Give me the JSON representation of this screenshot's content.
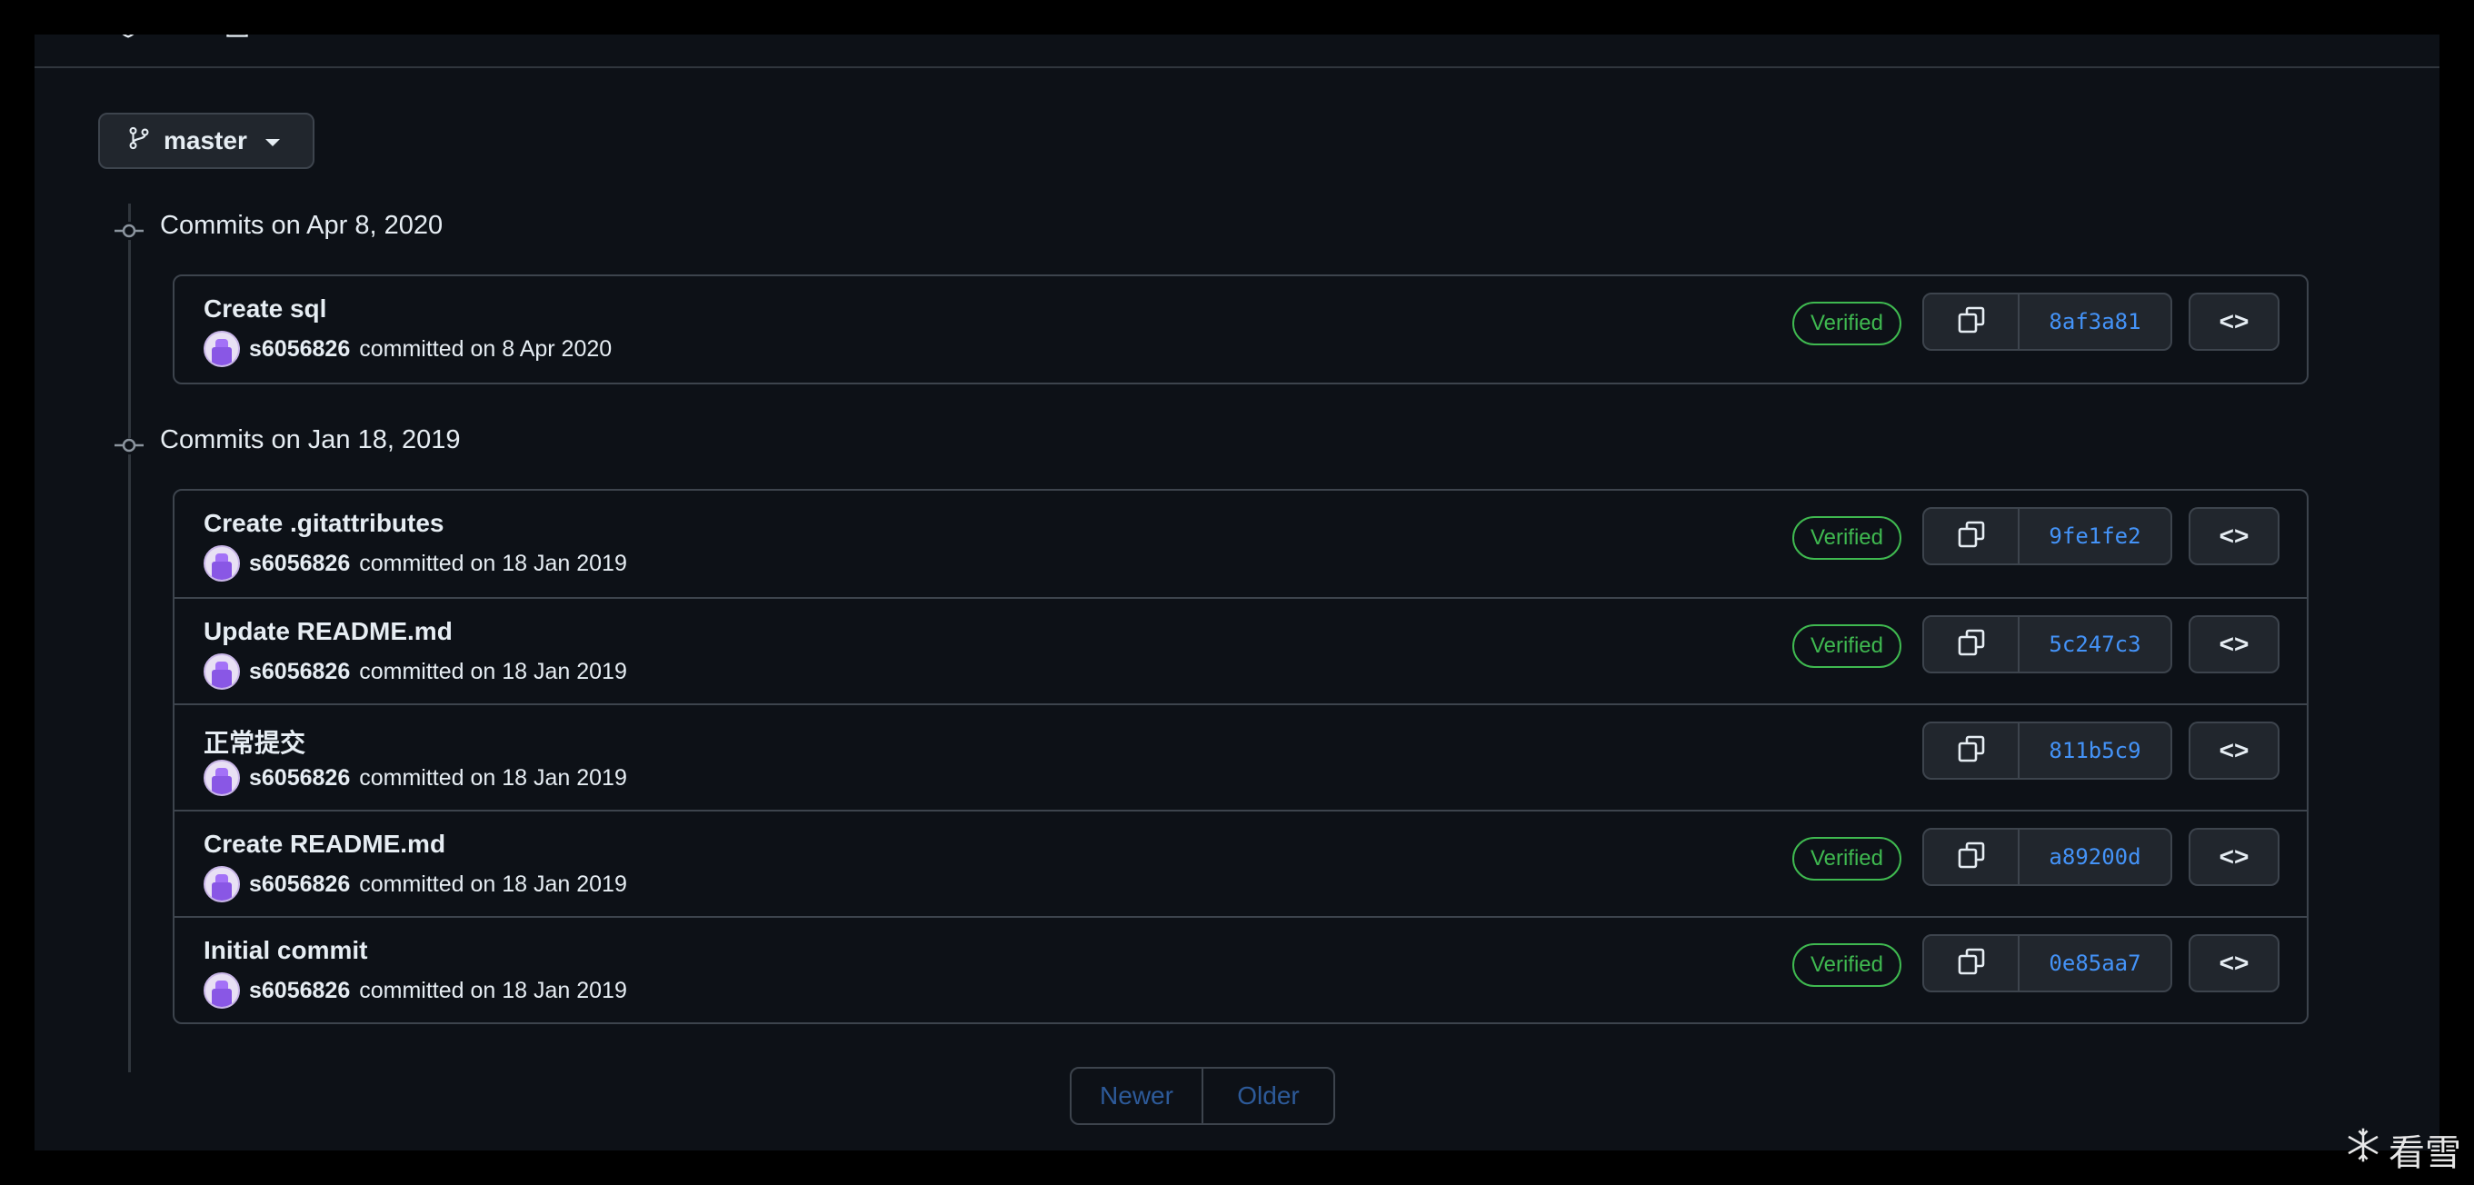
{
  "branch": {
    "name": "master"
  },
  "groups": [
    {
      "heading": "Commits on Apr 8, 2020",
      "commits": [
        {
          "title": "Create sql",
          "author": "s6056826",
          "meta": "committed on 8 Apr 2020",
          "verified": "Verified",
          "sha": "8af3a81"
        }
      ]
    },
    {
      "heading": "Commits on Jan 18, 2019",
      "commits": [
        {
          "title": "Create .gitattributes",
          "author": "s6056826",
          "meta": "committed on 18 Jan 2019",
          "verified": "Verified",
          "sha": "9fe1fe2"
        },
        {
          "title": "Update README.md",
          "author": "s6056826",
          "meta": "committed on 18 Jan 2019",
          "verified": "Verified",
          "sha": "5c247c3"
        },
        {
          "title": "正常提交",
          "author": "s6056826",
          "meta": "committed on 18 Jan 2019",
          "verified": "",
          "sha": "811b5c9"
        },
        {
          "title": "Create README.md",
          "author": "s6056826",
          "meta": "committed on 18 Jan 2019",
          "verified": "Verified",
          "sha": "a89200d"
        },
        {
          "title": "Initial commit",
          "author": "s6056826",
          "meta": "committed on 18 Jan 2019",
          "verified": "Verified",
          "sha": "0e85aa7"
        }
      ]
    }
  ],
  "pagination": {
    "newer": "Newer",
    "older": "Older"
  },
  "code_button": "<>",
  "watermark": "看雪",
  "colors": {
    "background": "#0d1117",
    "verified": "#3fb950",
    "sha_link": "#4493f8",
    "border": "#3d444d"
  }
}
